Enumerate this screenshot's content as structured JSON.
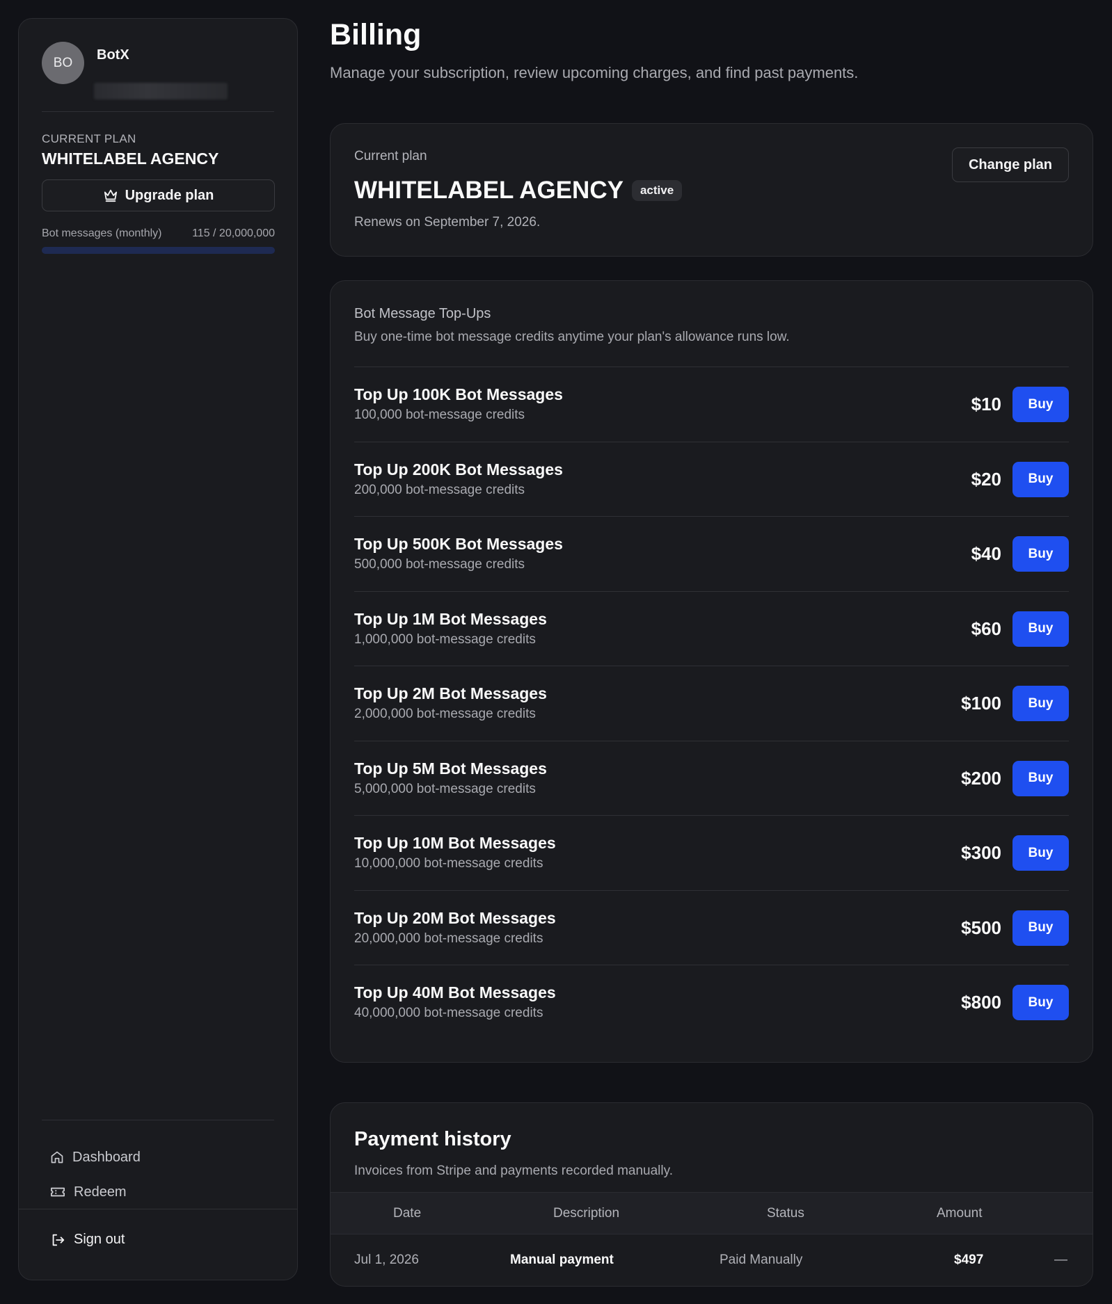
{
  "sidebar": {
    "avatar_initials": "BO",
    "user_name": "BotX",
    "plan_label": "CURRENT PLAN",
    "plan_name": "WHITELABEL AGENCY",
    "upgrade_label": "Upgrade plan",
    "usage_label": "Bot messages (monthly)",
    "usage_value": "115 / 20,000,000",
    "usage_fraction": 5.75e-06,
    "nav": [
      {
        "label": "Dashboard",
        "icon": "home-icon"
      },
      {
        "label": "Redeem",
        "icon": "ticket-icon"
      }
    ],
    "signout_label": "Sign out"
  },
  "page": {
    "title": "Billing",
    "subtitle": "Manage your subscription, review upcoming charges, and find past payments."
  },
  "plan_card": {
    "label": "Current plan",
    "name": "WHITELABEL AGENCY",
    "status": "active",
    "renew_text": "Renews on September 7, 2026.",
    "change_label": "Change plan"
  },
  "topups": {
    "title": "Bot Message Top-Ups",
    "description": "Buy one-time bot message credits anytime your plan's allowance runs low.",
    "buy_label": "Buy",
    "items": [
      {
        "name": "Top Up 100K Bot Messages",
        "credits": "100,000 bot-message credits",
        "price": "$10"
      },
      {
        "name": "Top Up 200K Bot Messages",
        "credits": "200,000 bot-message credits",
        "price": "$20"
      },
      {
        "name": "Top Up 500K Bot Messages",
        "credits": "500,000 bot-message credits",
        "price": "$40"
      },
      {
        "name": "Top Up 1M Bot Messages",
        "credits": "1,000,000 bot-message credits",
        "price": "$60"
      },
      {
        "name": "Top Up 2M Bot Messages",
        "credits": "2,000,000 bot-message credits",
        "price": "$100"
      },
      {
        "name": "Top Up 5M Bot Messages",
        "credits": "5,000,000 bot-message credits",
        "price": "$200"
      },
      {
        "name": "Top Up 10M Bot Messages",
        "credits": "10,000,000 bot-message credits",
        "price": "$300"
      },
      {
        "name": "Top Up 20M Bot Messages",
        "credits": "20,000,000 bot-message credits",
        "price": "$500"
      },
      {
        "name": "Top Up 40M Bot Messages",
        "credits": "40,000,000 bot-message credits",
        "price": "$800"
      }
    ]
  },
  "history": {
    "title": "Payment history",
    "description": "Invoices from Stripe and payments recorded manually.",
    "columns": [
      "Date",
      "Description",
      "Status",
      "Amount"
    ],
    "rows": [
      {
        "date": "Jul 1, 2026",
        "description": "Manual payment",
        "status": "Paid Manually",
        "amount": "$497",
        "action": "—"
      }
    ]
  },
  "colors": {
    "background": "#111217",
    "card": "#1a1b1f",
    "accent": "#1f4ff0"
  }
}
